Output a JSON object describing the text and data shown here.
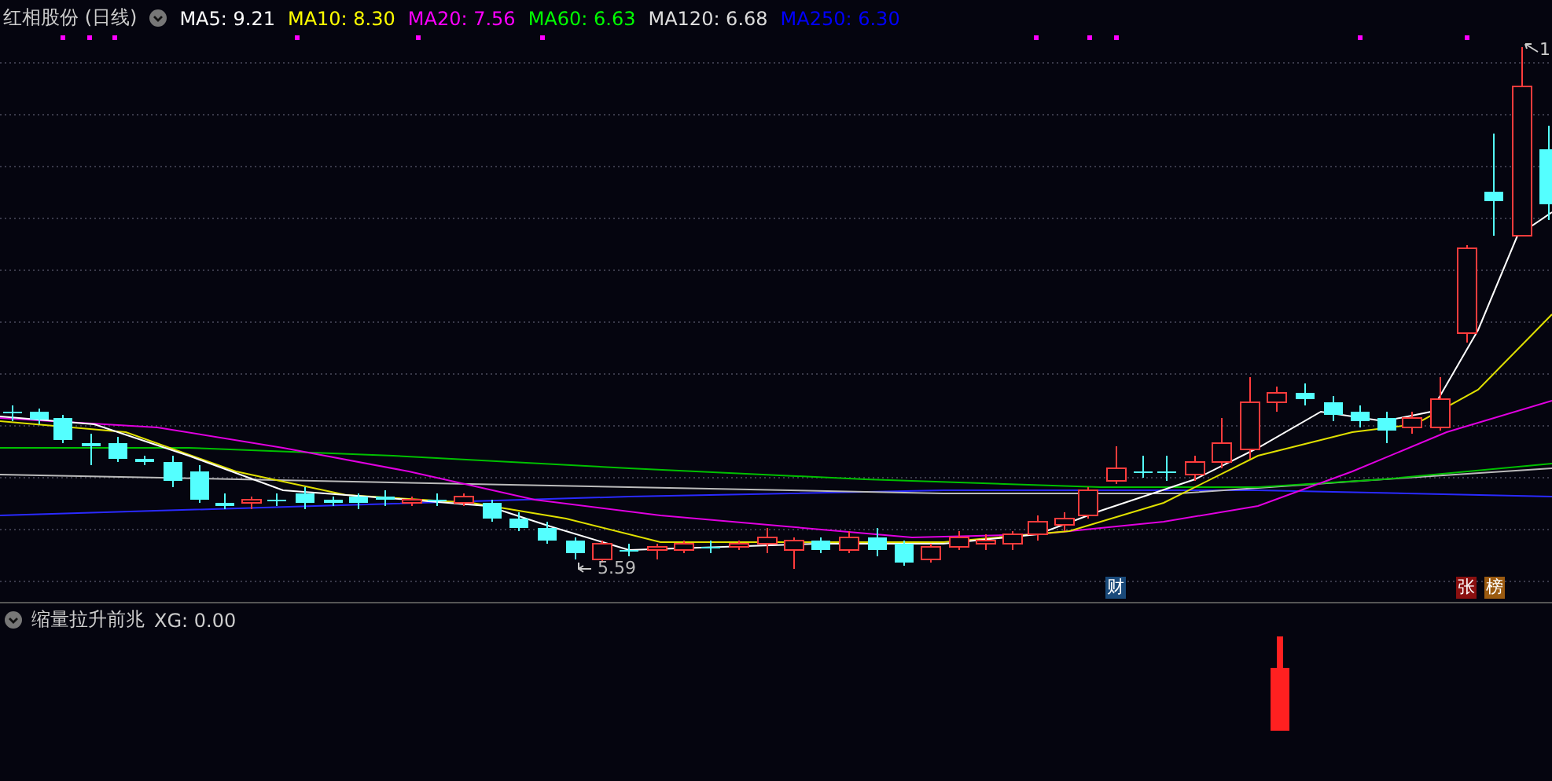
{
  "main_panel": {
    "stock_name": "红相股份 (日线)",
    "indicators": [
      {
        "name": "MA5:",
        "value": "9.21",
        "color": "#ffffff"
      },
      {
        "name": "MA10:",
        "value": "8.30",
        "color": "#ffff00"
      },
      {
        "name": "MA20:",
        "value": "7.56",
        "color": "#ff00ff"
      },
      {
        "name": "MA60:",
        "value": "6.63",
        "color": "#00ff00"
      },
      {
        "name": "MA120:",
        "value": "6.68",
        "color": "#dddddd"
      },
      {
        "name": "MA250:",
        "value": "6.30",
        "color": "#0000ff"
      }
    ],
    "low_marker": "5.59",
    "high_marker": "1",
    "badges": [
      {
        "label": "财",
        "color": "#1a4a7a"
      },
      {
        "label": "张",
        "color": "#8a1010"
      },
      {
        "label": "榜",
        "color": "#9a5a10"
      }
    ]
  },
  "lower_panel": {
    "indicator_name": "缩量拉升前兆",
    "reading": "XG: 0.00"
  }
}
